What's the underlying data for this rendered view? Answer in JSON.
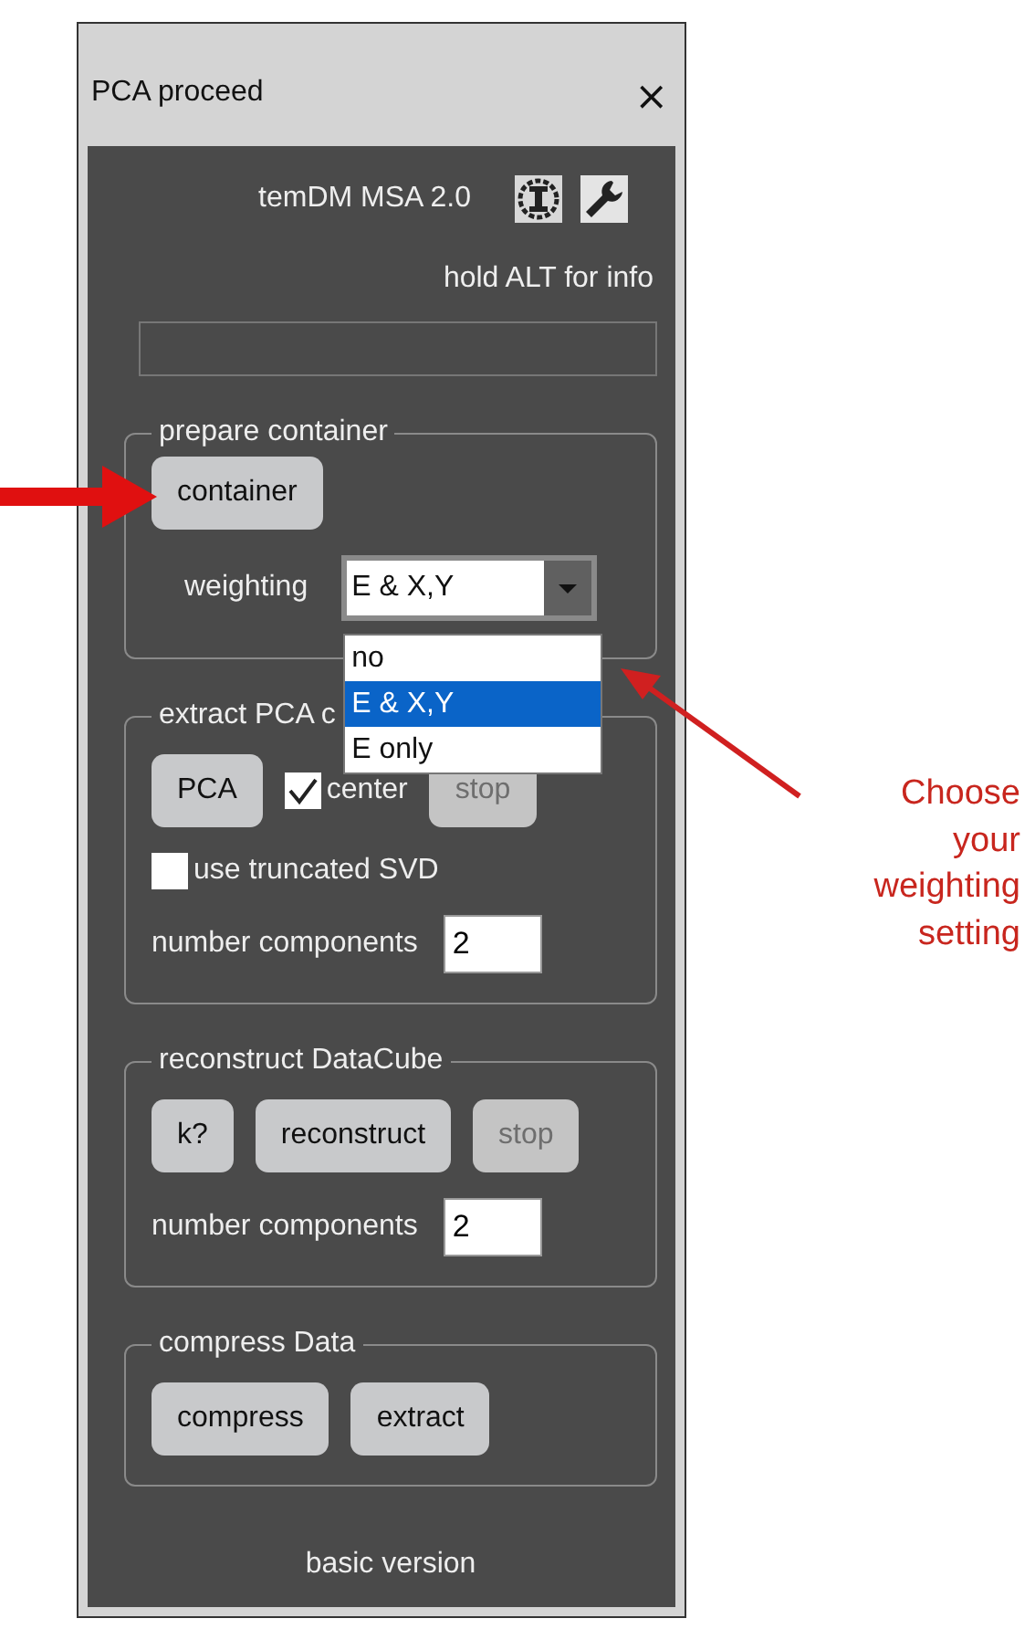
{
  "window": {
    "title": "PCA proceed",
    "close": "×"
  },
  "header": {
    "title": "temDM MSA 2.0",
    "hint": "hold ALT for info"
  },
  "groups": [
    {
      "title": "prepare container",
      "rows": [
        [
          {
            "kind": "button",
            "label": "container",
            "disabled": false
          }
        ],
        [
          {
            "kind": "combo",
            "label": "weighting",
            "value": "E & X,Y",
            "open": true,
            "options": [
              {
                "label": "no",
                "selected": false
              },
              {
                "label": "E & X,Y",
                "selected": true
              },
              {
                "label": "E only",
                "selected": false
              }
            ]
          }
        ]
      ]
    },
    {
      "title": "extract PCA c",
      "rows": [
        [
          {
            "kind": "button",
            "label": "PCA",
            "disabled": false
          },
          {
            "kind": "checkbox",
            "label": "center",
            "checked": true
          },
          {
            "kind": "button",
            "label": "stop",
            "disabled": true
          }
        ],
        [
          {
            "kind": "checkbox",
            "label": "use truncated SVD",
            "checked": false
          }
        ],
        [
          {
            "kind": "number",
            "label": "number components",
            "value": "2"
          }
        ]
      ]
    },
    {
      "title": "reconstruct DataCube",
      "rows": [
        [
          {
            "kind": "button",
            "label": "k?",
            "disabled": false
          },
          {
            "kind": "button",
            "label": "reconstruct",
            "disabled": false
          },
          {
            "kind": "button",
            "label": "stop",
            "disabled": true
          }
        ],
        [
          {
            "kind": "number",
            "label": "number components",
            "value": "2"
          }
        ]
      ]
    },
    {
      "title": "compress Data",
      "rows": [
        [
          {
            "kind": "button",
            "label": "compress",
            "disabled": false
          },
          {
            "kind": "button",
            "label": "extract",
            "disabled": false
          }
        ]
      ]
    }
  ],
  "footer": "basic version",
  "annotation": {
    "text": "Choose your weighting setting"
  }
}
